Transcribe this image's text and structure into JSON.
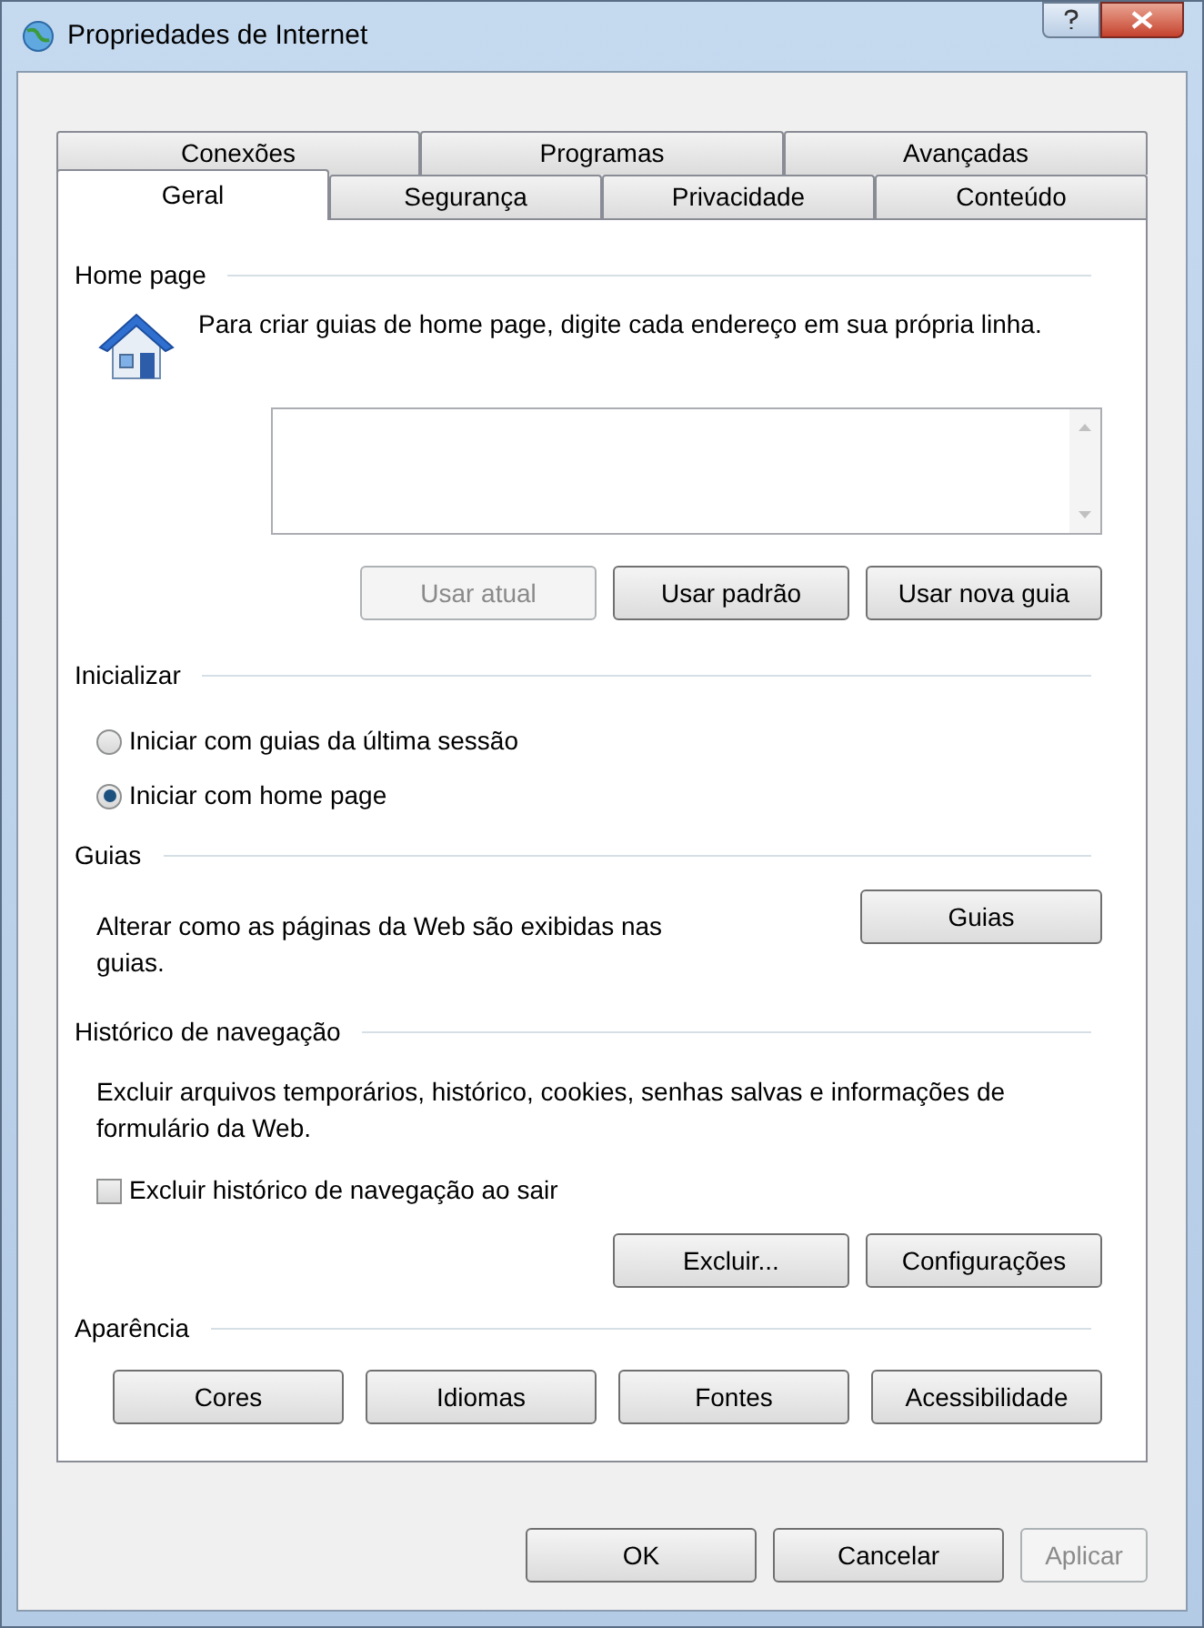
{
  "window": {
    "title": "Propriedades de Internet"
  },
  "tab_rows": [
    [
      {
        "label": "Conexões",
        "selected": false
      },
      {
        "label": "Programas",
        "selected": false
      },
      {
        "label": "Avançadas",
        "selected": false
      }
    ],
    [
      {
        "label": "Geral",
        "selected": true
      },
      {
        "label": "Segurança",
        "selected": false
      },
      {
        "label": "Privacidade",
        "selected": false
      },
      {
        "label": "Conteúdo",
        "selected": false
      }
    ]
  ],
  "home_page": {
    "heading": "Home page",
    "description": "Para criar guias de home page, digite cada endereço em sua própria linha.",
    "buttons": [
      {
        "label": "Usar atual",
        "disabled": true
      },
      {
        "label": "Usar padrão",
        "disabled": false
      },
      {
        "label": "Usar nova guia",
        "disabled": false
      }
    ]
  },
  "startup": {
    "heading": "Inicializar",
    "options": [
      {
        "label": "Iniciar com guias da última sessão",
        "selected": false
      },
      {
        "label": "Iniciar com home page",
        "selected": true
      }
    ]
  },
  "tabs_section": {
    "heading": "Guias",
    "description": "Alterar como as páginas da Web são exibidas nas guias.",
    "button": "Guias"
  },
  "history": {
    "heading": "Histórico de navegação",
    "description": "Excluir arquivos temporários, histórico, cookies, senhas salvas e informações de formulário da Web.",
    "checkbox": {
      "label": "Excluir histórico de navegação ao sair",
      "checked": false
    },
    "buttons": [
      "Excluir...",
      "Configurações"
    ]
  },
  "appearance": {
    "heading": "Aparência",
    "buttons": [
      "Cores",
      "Idiomas",
      "Fontes",
      "Acessibilidade"
    ]
  },
  "footer_buttons": [
    {
      "label": "OK",
      "disabled": false
    },
    {
      "label": "Cancelar",
      "disabled": false
    },
    {
      "label": "Aplicar",
      "disabled": true
    }
  ]
}
